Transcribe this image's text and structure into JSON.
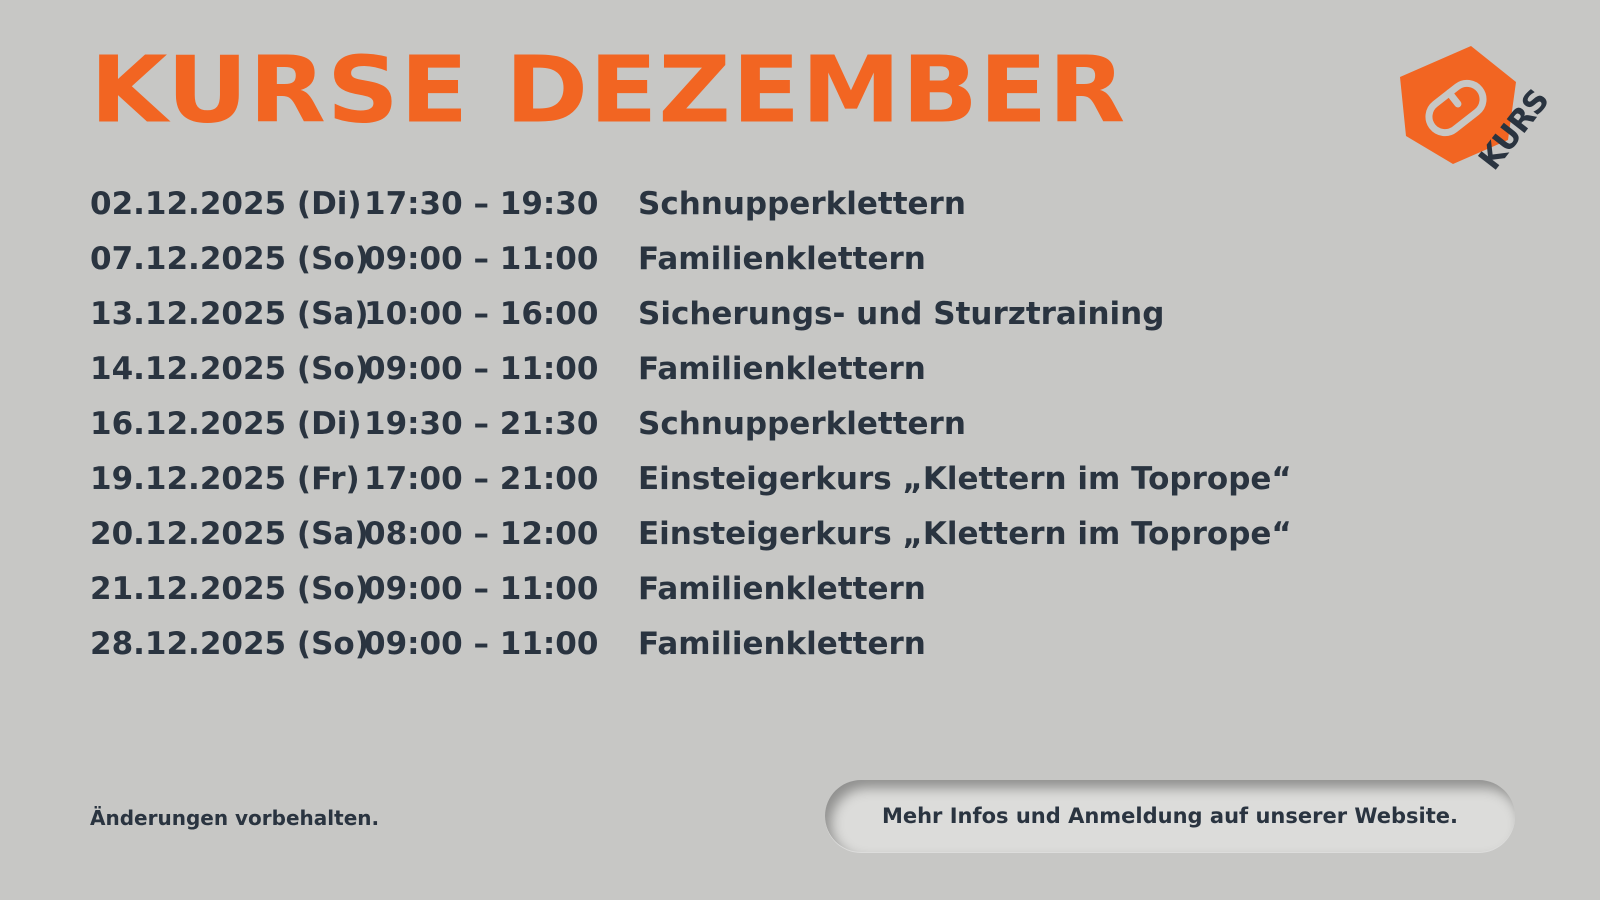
{
  "header": {
    "title": "KURSE DEZEMBER"
  },
  "logo": {
    "icon": "carabiner-hexagon-logo",
    "text": "KURS",
    "color_primary": "#f26522",
    "color_text": "#2a3440"
  },
  "colors": {
    "background": "#c7c7c5",
    "accent": "#f26522",
    "text": "#2a3440"
  },
  "schedule": [
    {
      "date": "02.12.2025 (Di)",
      "time": "17:30 – 19:30",
      "course": "Schnupperklettern"
    },
    {
      "date": "07.12.2025 (So)",
      "time": "09:00 – 11:00",
      "course": "Familienklettern"
    },
    {
      "date": "13.12.2025 (Sa)",
      "time": "10:00 – 16:00",
      "course": "Sicherungs- und Sturztraining"
    },
    {
      "date": "14.12.2025 (So)",
      "time": "09:00 – 11:00",
      "course": "Familienklettern"
    },
    {
      "date": "16.12.2025 (Di)",
      "time": "19:30 – 21:30",
      "course": "Schnupperklettern"
    },
    {
      "date": "19.12.2025 (Fr)",
      "time": "17:00 – 21:00",
      "course": "Einsteigerkurs „Klettern im Toprope“"
    },
    {
      "date": "20.12.2025 (Sa)",
      "time": "08:00 – 12:00",
      "course": "Einsteigerkurs „Klettern im Toprope“"
    },
    {
      "date": "21.12.2025 (So)",
      "time": "09:00 – 11:00",
      "course": "Familienklettern"
    },
    {
      "date": "28.12.2025 (So)",
      "time": "09:00 – 11:00",
      "course": "Familienklettern"
    }
  ],
  "footer": {
    "note": "Änderungen vorbehalten.",
    "info": "Mehr Infos und Anmeldung auf unserer Website."
  }
}
